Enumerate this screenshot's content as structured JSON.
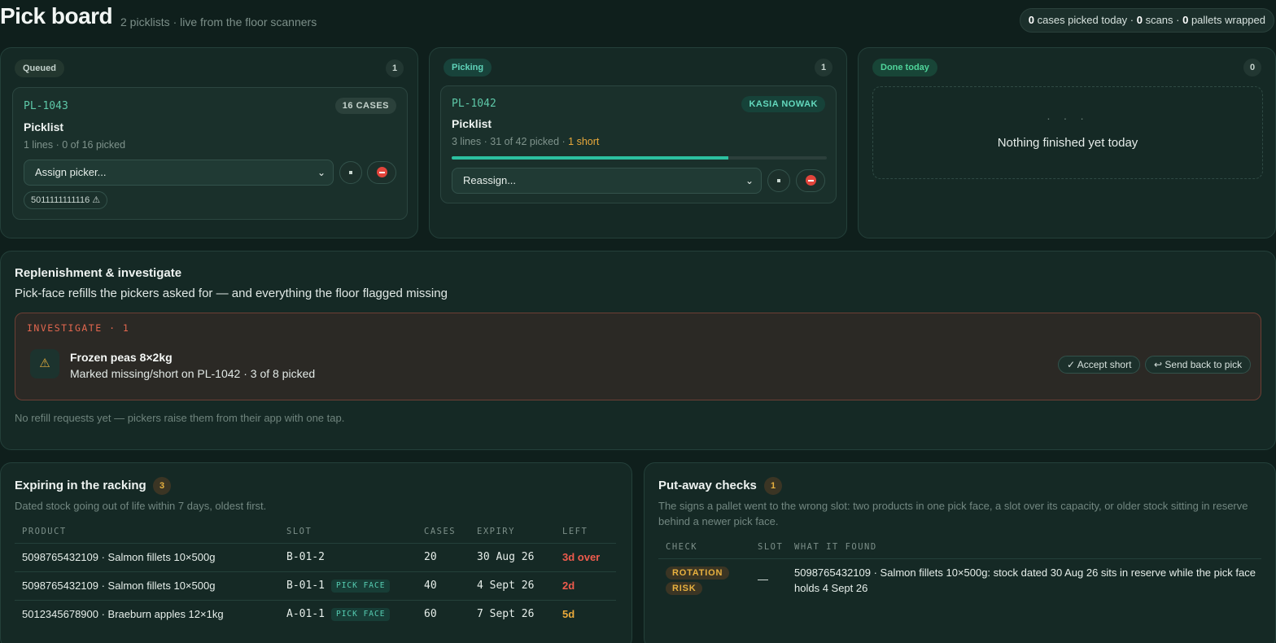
{
  "header": {
    "title": "Pick board",
    "subtitle": "2 picklists · live from the floor scanners",
    "stats": {
      "cases": "0",
      "cases_label": " cases picked today · ",
      "scans": "0",
      "scans_label": " scans · ",
      "pallets": "0",
      "pallets_label": " pallets wrapped"
    }
  },
  "columns": {
    "queued": {
      "label": "Queued",
      "count": "1",
      "card": {
        "id": "PL-1043",
        "tag": "16 CASES",
        "title": "Picklist",
        "meta": "1 lines · 0 of 16 picked",
        "select_value": "Assign picker...",
        "chip": "5011111111116 ⚠"
      }
    },
    "picking": {
      "label": "Picking",
      "count": "1",
      "card": {
        "id": "PL-1042",
        "tag": "KASIA NOWAK",
        "title": "Picklist",
        "meta": "3 lines · 31 of 42 picked · ",
        "short": "1 short",
        "progress": 0.738,
        "select_value": "Reassign..."
      }
    },
    "done": {
      "label": "Done today",
      "count": "0",
      "empty_dots": "· · ·",
      "empty_message": "Nothing finished yet today"
    }
  },
  "replenishment": {
    "title": "Replenishment & investigate",
    "subtitle": "Pick-face refills the pickers asked for — and everything the floor flagged missing",
    "investigate": {
      "label": "INVESTIGATE · 1",
      "icon": "warning-icon",
      "item": "Frozen peas 8×2kg",
      "desc": "Marked missing/short on PL-1042 · 3 of 8 picked",
      "accept": "✓ Accept short",
      "send_back": "↩ Send back to pick"
    },
    "note": "No refill requests yet — pickers raise them from their app with one tap."
  },
  "expiring": {
    "title": "Expiring in the racking",
    "count": "3",
    "subtitle": "Dated stock going out of life within 7 days, oldest first.",
    "columns": [
      "PRODUCT",
      "SLOT",
      "CASES",
      "EXPIRY",
      "LEFT"
    ],
    "rows": [
      {
        "product": "5098765432109 · Salmon fillets 10×500g",
        "slot": "B-01-2",
        "pick_face": "",
        "cases": "20",
        "expiry": "30 Aug 26",
        "left": "3d over"
      },
      {
        "product": "5098765432109 · Salmon fillets 10×500g",
        "slot": "B-01-1",
        "pick_face": "PICK FACE",
        "cases": "40",
        "expiry": "4 Sept 26",
        "left": "2d"
      },
      {
        "product": "5012345678900 · Braeburn apples 12×1kg",
        "slot": "A-01-1",
        "pick_face": "PICK FACE",
        "cases": "60",
        "expiry": "7 Sept 26",
        "left": "5d"
      }
    ],
    "colors": {
      "over": "#ef5b4d",
      "soon": "#e9a93b"
    }
  },
  "putaway": {
    "title": "Put-away checks",
    "count": "1",
    "subtitle": "The signs a pallet went to the wrong slot: two products in one pick face, a slot over its capacity, or older stock sitting in reserve behind a newer pick face.",
    "columns": [
      "CHECK",
      "SLOT",
      "WHAT IT FOUND"
    ],
    "rows": [
      {
        "check_1": "ROTATION",
        "check_2": "RISK",
        "slot": "—",
        "found": "5098765432109 · Salmon fillets 10×500g: stock dated 30 Aug 26 sits in reserve while the pick face holds 4 Sept 26"
      }
    ]
  }
}
